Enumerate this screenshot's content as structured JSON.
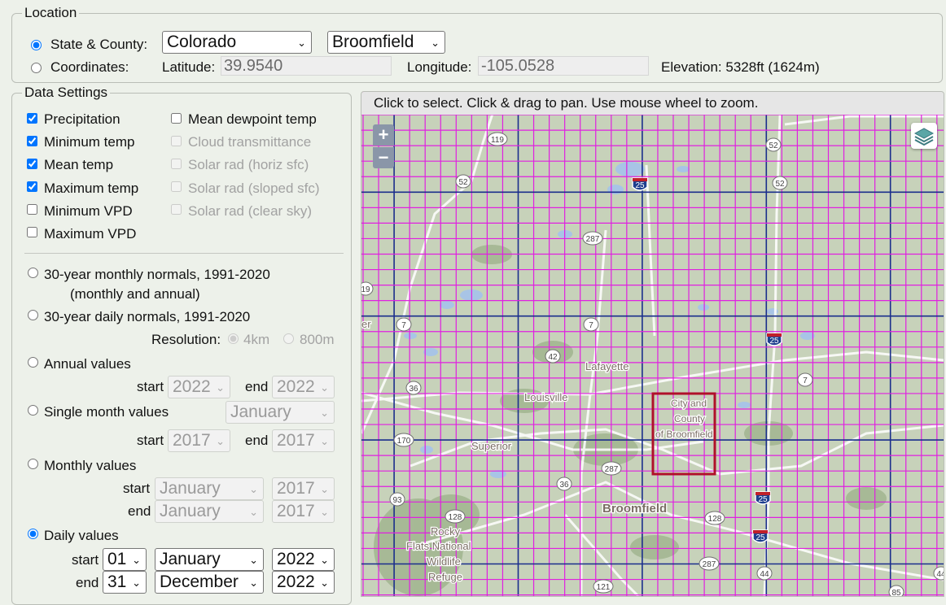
{
  "location": {
    "legend": "Location",
    "state_county_label": "State & County:",
    "state_value": "Colorado",
    "county_value": "Broomfield",
    "coordinates_label": "Coordinates:",
    "latitude_label": "Latitude:",
    "latitude_value": "39.9540",
    "longitude_label": "Longitude:",
    "longitude_value": "-105.0528",
    "elevation_text": "Elevation: 5328ft (1624m)"
  },
  "data_settings": {
    "legend": "Data Settings",
    "variables": [
      {
        "label": "Precipitation",
        "checked": true,
        "enabled": true
      },
      {
        "label": "Minimum temp",
        "checked": true,
        "enabled": true
      },
      {
        "label": "Mean temp",
        "checked": true,
        "enabled": true
      },
      {
        "label": "Maximum temp",
        "checked": true,
        "enabled": true
      },
      {
        "label": "Minimum VPD",
        "checked": false,
        "enabled": true
      },
      {
        "label": "Maximum VPD",
        "checked": false,
        "enabled": true
      },
      {
        "label": "Mean dewpoint temp",
        "checked": false,
        "enabled": true
      },
      {
        "label": "Cloud transmittance",
        "checked": false,
        "enabled": false
      },
      {
        "label": "Solar rad (horiz sfc)",
        "checked": false,
        "enabled": false
      },
      {
        "label": "Solar rad (sloped sfc)",
        "checked": false,
        "enabled": false
      },
      {
        "label": "Solar rad (clear sky)",
        "checked": false,
        "enabled": false
      }
    ],
    "monthly_normals_label": "30-year monthly normals, 1991-2020",
    "monthly_normals_sub": "(monthly and annual)",
    "daily_normals_label": "30-year daily normals, 1991-2020",
    "resolution_label": "Resolution:",
    "res_4km": "4km",
    "res_800m": "800m",
    "annual_label": "Annual values",
    "annual_start": "2022",
    "annual_end": "2022",
    "single_month_label": "Single month values",
    "single_month_value": "January",
    "single_month_start": "2017",
    "single_month_end": "2017",
    "monthly_label": "Monthly values",
    "monthly_start_month": "January",
    "monthly_start_year": "2017",
    "monthly_end_month": "January",
    "monthly_end_year": "2017",
    "daily_label": "Daily values",
    "daily_start_day": "01",
    "daily_start_month": "January",
    "daily_start_year": "2022",
    "daily_end_day": "31",
    "daily_end_month": "December",
    "daily_end_year": "2022",
    "start_label": "start",
    "end_label": "end",
    "selected_mode": "Daily values"
  },
  "map": {
    "instructions": "Click to select.   Click & drag to pan.   Use mouse wheel to zoom.",
    "zoom_in": "+",
    "zoom_out": "−",
    "place_labels": [
      "Lafayette",
      "Louisville",
      "Superior",
      "Broomfield",
      "Rocky",
      "Flats National",
      "Wildlife",
      "Refuge",
      "er"
    ],
    "county_label_lines": [
      "City and",
      "County",
      "of Broomfield"
    ],
    "route_shields": [
      "119",
      "52",
      "52",
      "25",
      "52",
      "287",
      "19",
      "7",
      "7",
      "42",
      "25",
      "7",
      "36",
      "170",
      "287",
      "36",
      "25",
      "93",
      "128",
      "128",
      "25",
      "287",
      "44",
      "121",
      "85",
      "44"
    ],
    "grid_color": "#e020e0",
    "major_grid_color": "#1a2e8c",
    "selection_color": "#b0102a"
  }
}
